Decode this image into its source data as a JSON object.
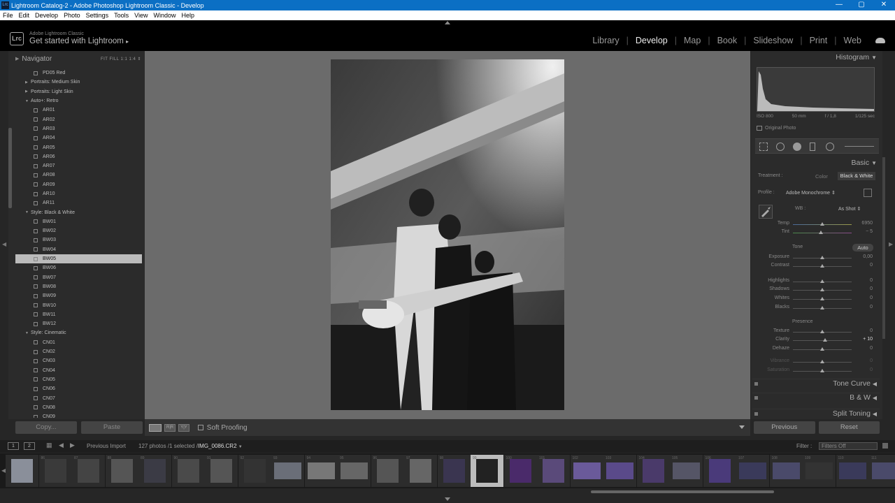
{
  "window": {
    "title": "Lightroom Catalog-2 - Adobe Photoshop Lightroom Classic - Develop",
    "app_icon": "Lrc",
    "controls": [
      "—",
      "▢",
      "✕"
    ]
  },
  "menubar": [
    "File",
    "Edit",
    "Develop",
    "Photo",
    "Settings",
    "Tools",
    "View",
    "Window",
    "Help"
  ],
  "header": {
    "logo": "Lrc",
    "subtitle": "Adobe Lightroom Classic",
    "main": "Get started with Lightroom",
    "arrow": "▸"
  },
  "modules": [
    {
      "label": "Library",
      "active": false
    },
    {
      "label": "Develop",
      "active": true
    },
    {
      "label": "Map",
      "active": false
    },
    {
      "label": "Book",
      "active": false
    },
    {
      "label": "Slideshow",
      "active": false
    },
    {
      "label": "Print",
      "active": false
    },
    {
      "label": "Web",
      "active": false
    }
  ],
  "navigator": {
    "title": "Navigator",
    "options": "FIT  FILL  1:1  1:4 ⇕"
  },
  "presets": [
    {
      "type": "item",
      "label": "PD05 Red"
    },
    {
      "type": "group",
      "label": "Portraits: Medium Skin",
      "open": false
    },
    {
      "type": "group",
      "label": "Portraits: Light Skin",
      "open": false
    },
    {
      "type": "group",
      "label": "Auto+: Retro",
      "open": true
    },
    {
      "type": "item",
      "label": "AR01"
    },
    {
      "type": "item",
      "label": "AR02"
    },
    {
      "type": "item",
      "label": "AR03"
    },
    {
      "type": "item",
      "label": "AR04"
    },
    {
      "type": "item",
      "label": "AR05"
    },
    {
      "type": "item",
      "label": "AR06"
    },
    {
      "type": "item",
      "label": "AR07"
    },
    {
      "type": "item",
      "label": "AR08"
    },
    {
      "type": "item",
      "label": "AR09"
    },
    {
      "type": "item",
      "label": "AR10"
    },
    {
      "type": "item",
      "label": "AR11"
    },
    {
      "type": "group",
      "label": "Style: Black & White",
      "open": true
    },
    {
      "type": "item",
      "label": "BW01"
    },
    {
      "type": "item",
      "label": "BW02"
    },
    {
      "type": "item",
      "label": "BW03"
    },
    {
      "type": "item",
      "label": "BW04"
    },
    {
      "type": "item",
      "label": "BW05",
      "selected": true
    },
    {
      "type": "item",
      "label": "BW06"
    },
    {
      "type": "item",
      "label": "BW07"
    },
    {
      "type": "item",
      "label": "BW08"
    },
    {
      "type": "item",
      "label": "BW09"
    },
    {
      "type": "item",
      "label": "BW10"
    },
    {
      "type": "item",
      "label": "BW11"
    },
    {
      "type": "item",
      "label": "BW12"
    },
    {
      "type": "group",
      "label": "Style: Cinematic",
      "open": true
    },
    {
      "type": "item",
      "label": "CN01"
    },
    {
      "type": "item",
      "label": "CN02"
    },
    {
      "type": "item",
      "label": "CN03"
    },
    {
      "type": "item",
      "label": "CN04"
    },
    {
      "type": "item",
      "label": "CN05"
    },
    {
      "type": "item",
      "label": "CN06"
    },
    {
      "type": "item",
      "label": "CN07"
    },
    {
      "type": "item",
      "label": "CN08"
    },
    {
      "type": "item",
      "label": "CN09"
    }
  ],
  "left_buttons": {
    "copy": "Copy...",
    "paste": "Paste"
  },
  "toolbar": {
    "soft_proofing": "Soft Proofing",
    "compare": "R|R",
    "survey": "Y|Y"
  },
  "histogram": {
    "title": "Histogram",
    "iso": "ISO 800",
    "focal": "50 mm",
    "aperture": "f / 1,8",
    "shutter": "1/125 sec",
    "original_photo": "Original Photo"
  },
  "basic": {
    "title": "Basic",
    "treatment_label": "Treatment :",
    "treatment_color": "Color",
    "treatment_bw": "Black & White",
    "profile_label": "Profile :",
    "profile_value": "Adobe Monochrome ⇕",
    "wb_label": "WB :",
    "wb_value": "As Shot ⇕",
    "tone_label": "Tone",
    "auto": "Auto",
    "presence_label": "Presence",
    "sliders": [
      {
        "key": "temp",
        "label": "Temp",
        "value": "6950",
        "pos": 0.5
      },
      {
        "key": "tint",
        "label": "Tint",
        "value": "− 5",
        "pos": 0.48
      },
      {
        "key": "exposure",
        "label": "Exposure",
        "value": "0,00",
        "pos": 0.5
      },
      {
        "key": "contrast",
        "label": "Contrast",
        "value": "0",
        "pos": 0.5
      },
      {
        "key": "highlights",
        "label": "Highlights",
        "value": "0",
        "pos": 0.5
      },
      {
        "key": "shadows",
        "label": "Shadows",
        "value": "0",
        "pos": 0.5
      },
      {
        "key": "whites",
        "label": "Whites",
        "value": "0",
        "pos": 0.5
      },
      {
        "key": "blacks",
        "label": "Blacks",
        "value": "0",
        "pos": 0.5
      },
      {
        "key": "texture",
        "label": "Texture",
        "value": "0",
        "pos": 0.5
      },
      {
        "key": "clarity",
        "label": "Clarity",
        "value": "+ 10",
        "pos": 0.55
      },
      {
        "key": "dehaze",
        "label": "Dehaze",
        "value": "0",
        "pos": 0.5
      },
      {
        "key": "vibrance",
        "label": "Vibrance",
        "value": "0",
        "pos": 0.5
      },
      {
        "key": "saturation",
        "label": "Saturation",
        "value": "0",
        "pos": 0.5
      }
    ]
  },
  "collapsed_panels": [
    "Tone Curve",
    "B & W",
    "Split Toning"
  ],
  "right_buttons": {
    "previous": "Previous",
    "reset": "Reset"
  },
  "filmstrip_bar": {
    "view1": "1",
    "view2": "2",
    "source": "Previous Import",
    "count": "127 photos /1 selected /",
    "filename": "IMG_0086.CR2",
    "filter_label": "Filter :",
    "filter_value": "Filters Off"
  },
  "filmstrip": [
    {
      "num": "",
      "tone": "#8a8f9a",
      "orient": "p",
      "sel": false
    },
    {
      "num": "86",
      "tone": "#3a3a3a",
      "orient": "p",
      "sel": false
    },
    {
      "num": "87",
      "tone": "#444",
      "orient": "p",
      "sel": false
    },
    {
      "num": "88",
      "tone": "#555",
      "orient": "p",
      "sel": false
    },
    {
      "num": "89",
      "tone": "#3b3b45",
      "orient": "p",
      "sel": false
    },
    {
      "num": "90",
      "tone": "#4a4a4a",
      "orient": "p",
      "sel": false
    },
    {
      "num": "91",
      "tone": "#555",
      "orient": "p",
      "sel": false
    },
    {
      "num": "92",
      "tone": "#333",
      "orient": "p",
      "sel": false
    },
    {
      "num": "93",
      "tone": "#6a6e78",
      "orient": "l",
      "sel": false
    },
    {
      "num": "94",
      "tone": "#777",
      "orient": "l",
      "sel": false
    },
    {
      "num": "95",
      "tone": "#666",
      "orient": "l",
      "sel": false
    },
    {
      "num": "96",
      "tone": "#555",
      "orient": "p",
      "sel": false
    },
    {
      "num": "97",
      "tone": "#666",
      "orient": "p",
      "sel": false
    },
    {
      "num": "98",
      "tone": "#3a3550",
      "orient": "p",
      "sel": false
    },
    {
      "num": "99",
      "tone": "#222",
      "orient": "p",
      "sel": true
    },
    {
      "num": "100",
      "tone": "#4a2a6a",
      "orient": "p",
      "sel": false
    },
    {
      "num": "101",
      "tone": "#5a4a7a",
      "orient": "p",
      "sel": false
    },
    {
      "num": "102",
      "tone": "#6a5a9a",
      "orient": "l",
      "sel": false
    },
    {
      "num": "103",
      "tone": "#5a4a8a",
      "orient": "l",
      "sel": false
    },
    {
      "num": "104",
      "tone": "#4a3a6a",
      "orient": "p",
      "sel": false
    },
    {
      "num": "105",
      "tone": "#556",
      "orient": "l",
      "sel": false
    },
    {
      "num": "106",
      "tone": "#4a3a7a",
      "orient": "p",
      "sel": false
    },
    {
      "num": "107",
      "tone": "#3a3a5a",
      "orient": "l",
      "sel": false
    },
    {
      "num": "108",
      "tone": "#4a4a6a",
      "orient": "l",
      "sel": false
    },
    {
      "num": "109",
      "tone": "#333",
      "orient": "l",
      "sel": false
    },
    {
      "num": "110",
      "tone": "#3a3a5a",
      "orient": "l",
      "sel": false
    },
    {
      "num": "111",
      "tone": "#4a4a6a",
      "orient": "l",
      "sel": false
    }
  ]
}
